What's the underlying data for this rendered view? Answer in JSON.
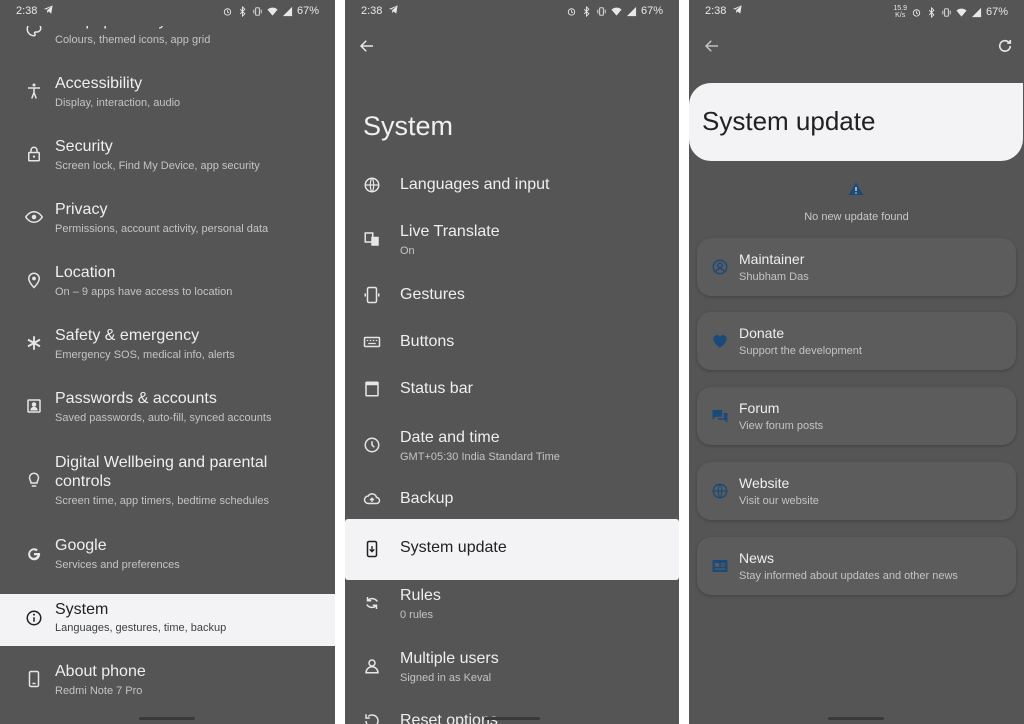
{
  "status": {
    "time": "2:38",
    "battery": "67%",
    "net_speed_top": "15.9",
    "net_speed_bottom": "K/s"
  },
  "settings_list": {
    "items": [
      {
        "title": "Wallpaper & style",
        "subtitle": "Colours, themed icons, app grid",
        "icon": "palette-icon"
      },
      {
        "title": "Accessibility",
        "subtitle": "Display, interaction, audio",
        "icon": "accessibility-icon"
      },
      {
        "title": "Security",
        "subtitle": "Screen lock, Find My Device, app security",
        "icon": "lock-icon"
      },
      {
        "title": "Privacy",
        "subtitle": "Permissions, account activity, personal data",
        "icon": "eye-icon"
      },
      {
        "title": "Location",
        "subtitle": "On – 9 apps have access to location",
        "icon": "location-pin-icon"
      },
      {
        "title": "Safety & emergency",
        "subtitle": "Emergency SOS, medical info, alerts",
        "icon": "asterisk-icon"
      },
      {
        "title": "Passwords & accounts",
        "subtitle": "Saved passwords, auto-fill, synced accounts",
        "icon": "account-box-icon"
      },
      {
        "title": "Digital Wellbeing and parental",
        "title2": "controls",
        "subtitle": "Screen time, app timers, bedtime schedules",
        "icon": "wellbeing-icon"
      },
      {
        "title": "Google",
        "subtitle": "Services and preferences",
        "icon": "google-icon"
      },
      {
        "title": "System",
        "subtitle": "Languages, gestures, time, backup",
        "icon": "info-icon",
        "highlighted": true
      },
      {
        "title": "About phone",
        "subtitle": "Redmi Note 7 Pro",
        "icon": "phone-icon"
      }
    ]
  },
  "system_screen": {
    "title": "System",
    "items": [
      {
        "title": "Languages and input",
        "icon": "globe-icon"
      },
      {
        "title": "Live Translate",
        "subtitle": "On",
        "icon": "translate-icon"
      },
      {
        "title": "Gestures",
        "icon": "gesture-phone-icon"
      },
      {
        "title": "Buttons",
        "icon": "keyboard-icon"
      },
      {
        "title": "Status bar",
        "icon": "status-bar-icon"
      },
      {
        "title": "Date and time",
        "subtitle": "GMT+05:30 India Standard Time",
        "icon": "clock-icon"
      },
      {
        "title": "Backup",
        "icon": "cloud-upload-icon"
      },
      {
        "title": "System update",
        "icon": "system-update-icon",
        "highlighted": true
      },
      {
        "title": "Rules",
        "subtitle": "0 rules",
        "icon": "rules-icon"
      },
      {
        "title": "Multiple users",
        "subtitle": "Signed in as Keval",
        "icon": "person-icon"
      },
      {
        "title": "Reset options",
        "icon": "reset-icon"
      }
    ]
  },
  "update_screen": {
    "title": "System update",
    "status_text": "No new update found",
    "cards": [
      {
        "title": "Maintainer",
        "subtitle": "Shubham Das",
        "icon": "account-circle-icon"
      },
      {
        "title": "Donate",
        "subtitle": "Support the development",
        "icon": "heart-icon"
      },
      {
        "title": "Forum",
        "subtitle": "View forum posts",
        "icon": "forum-icon"
      },
      {
        "title": "Website",
        "subtitle": "Visit our website",
        "icon": "globe-icon"
      },
      {
        "title": "News",
        "subtitle": "Stay informed about updates and other news",
        "icon": "news-icon"
      }
    ]
  },
  "colors": {
    "dim_background": "#555555",
    "highlight": "#f3f3f5",
    "accent_blue": "#1a4a7a"
  }
}
